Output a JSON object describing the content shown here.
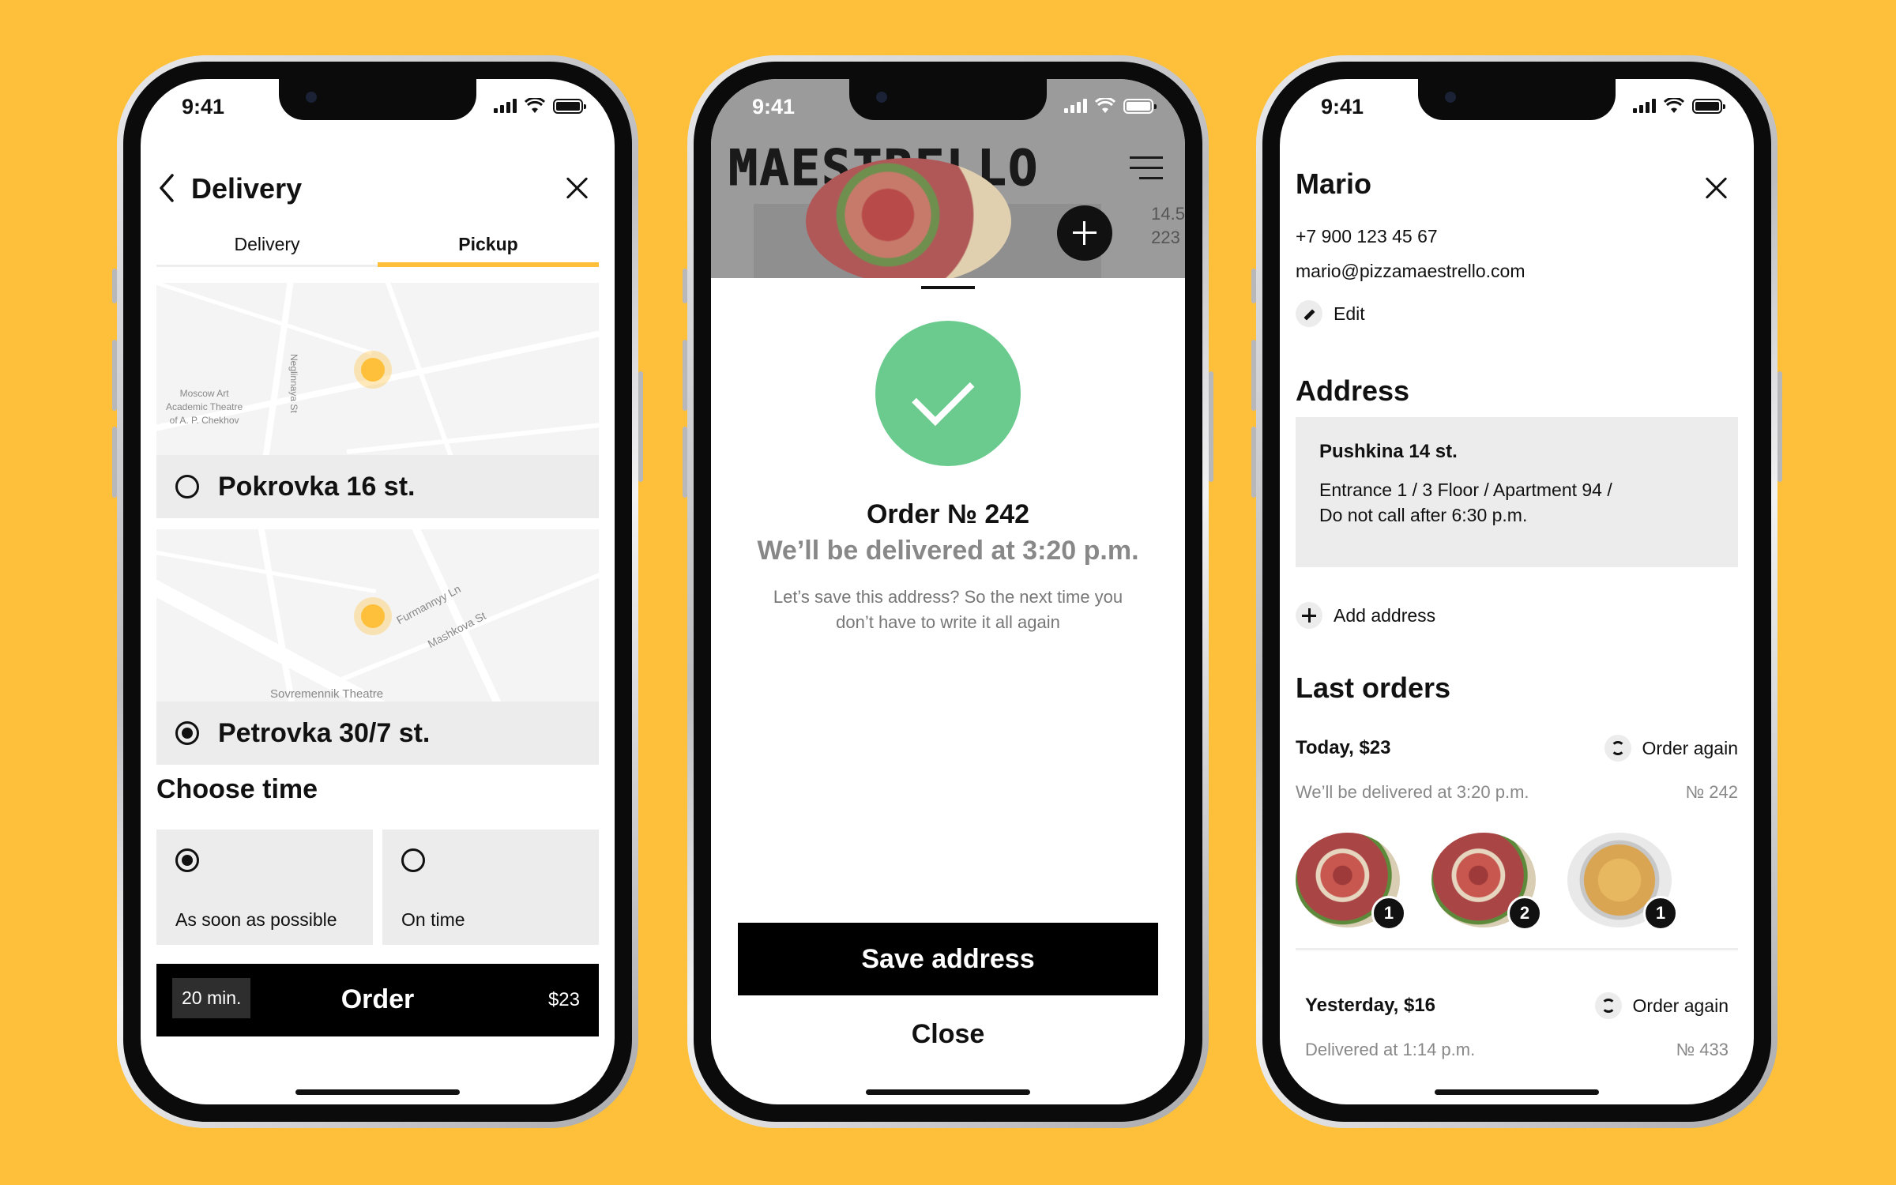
{
  "status": {
    "time": "9:41"
  },
  "screen1": {
    "title": "Delivery",
    "tabs": [
      "Delivery",
      "Pickup"
    ],
    "active_tab": "Pickup",
    "locations": [
      {
        "name": "Pokrovka 16 st.",
        "selected": false,
        "map_labels": {
          "street": "Neglinnaya St",
          "place_line1": "Moscow Art",
          "place_line2": "Academic Theatre",
          "place_line3": "of A. P. Chekhov"
        }
      },
      {
        "name": "Petrovka 30/7 st.",
        "selected": true,
        "map_labels": {
          "street1": "Furmannyy Ln",
          "street2": "Mashkova St",
          "place": "Sovremennik Theatre"
        }
      }
    ],
    "choose_time": "Choose time",
    "time_options": [
      {
        "label": "As soon as possible",
        "selected": true
      },
      {
        "label": "On time",
        "selected": false
      }
    ],
    "order_bar": {
      "eta": "20 min.",
      "label": "Order",
      "price": "$23"
    }
  },
  "screen2": {
    "brand": "MAESTRELLO",
    "side_numbers": [
      "14.5",
      "223"
    ],
    "order_no": "Order № 242",
    "delivery_time": "We’ll be delivered at 3:20 p.m.",
    "message_line1": "Let’s save this address? So the next time you",
    "message_line2": "don’t have to write it all again",
    "save_label": "Save address",
    "close_label": "Close"
  },
  "screen3": {
    "name": "Mario",
    "phone": "+7 900 123 45 67",
    "email": "mario@pizzamaestrello.com",
    "edit_label": "Edit",
    "address_heading": "Address",
    "address": {
      "title": "Pushkina 14 st.",
      "line1": "Entrance 1  / 3 Floor / Apartment 94 /",
      "line2": "Do not call after 6:30 p.m."
    },
    "add_address_label": "Add address",
    "last_orders_heading": "Last orders",
    "orders": [
      {
        "date": "Today, $23",
        "again": "Order again",
        "status": "We’ll be delivered at 3:20 p.m.",
        "number": "№ 242",
        "items": [
          {
            "kind": "pizza",
            "count": "1"
          },
          {
            "kind": "pizza",
            "count": "2"
          },
          {
            "kind": "soup",
            "count": "1"
          }
        ]
      },
      {
        "date": "Yesterday, $16",
        "again": "Order again",
        "status": "Delivered at 1:14 p.m.",
        "number": "№ 433"
      }
    ]
  },
  "colors": {
    "background": "#FEC03A",
    "accent": "#FEC03A",
    "success": "#6BCB8E",
    "dark": "#000000"
  },
  "icons": [
    "back-chevron-icon",
    "close-icon",
    "menu-icon",
    "plus-icon",
    "check-icon",
    "edit-pencil-icon",
    "refresh-icon",
    "signal-icon",
    "wifi-icon",
    "battery-icon",
    "map-pin-icon"
  ]
}
